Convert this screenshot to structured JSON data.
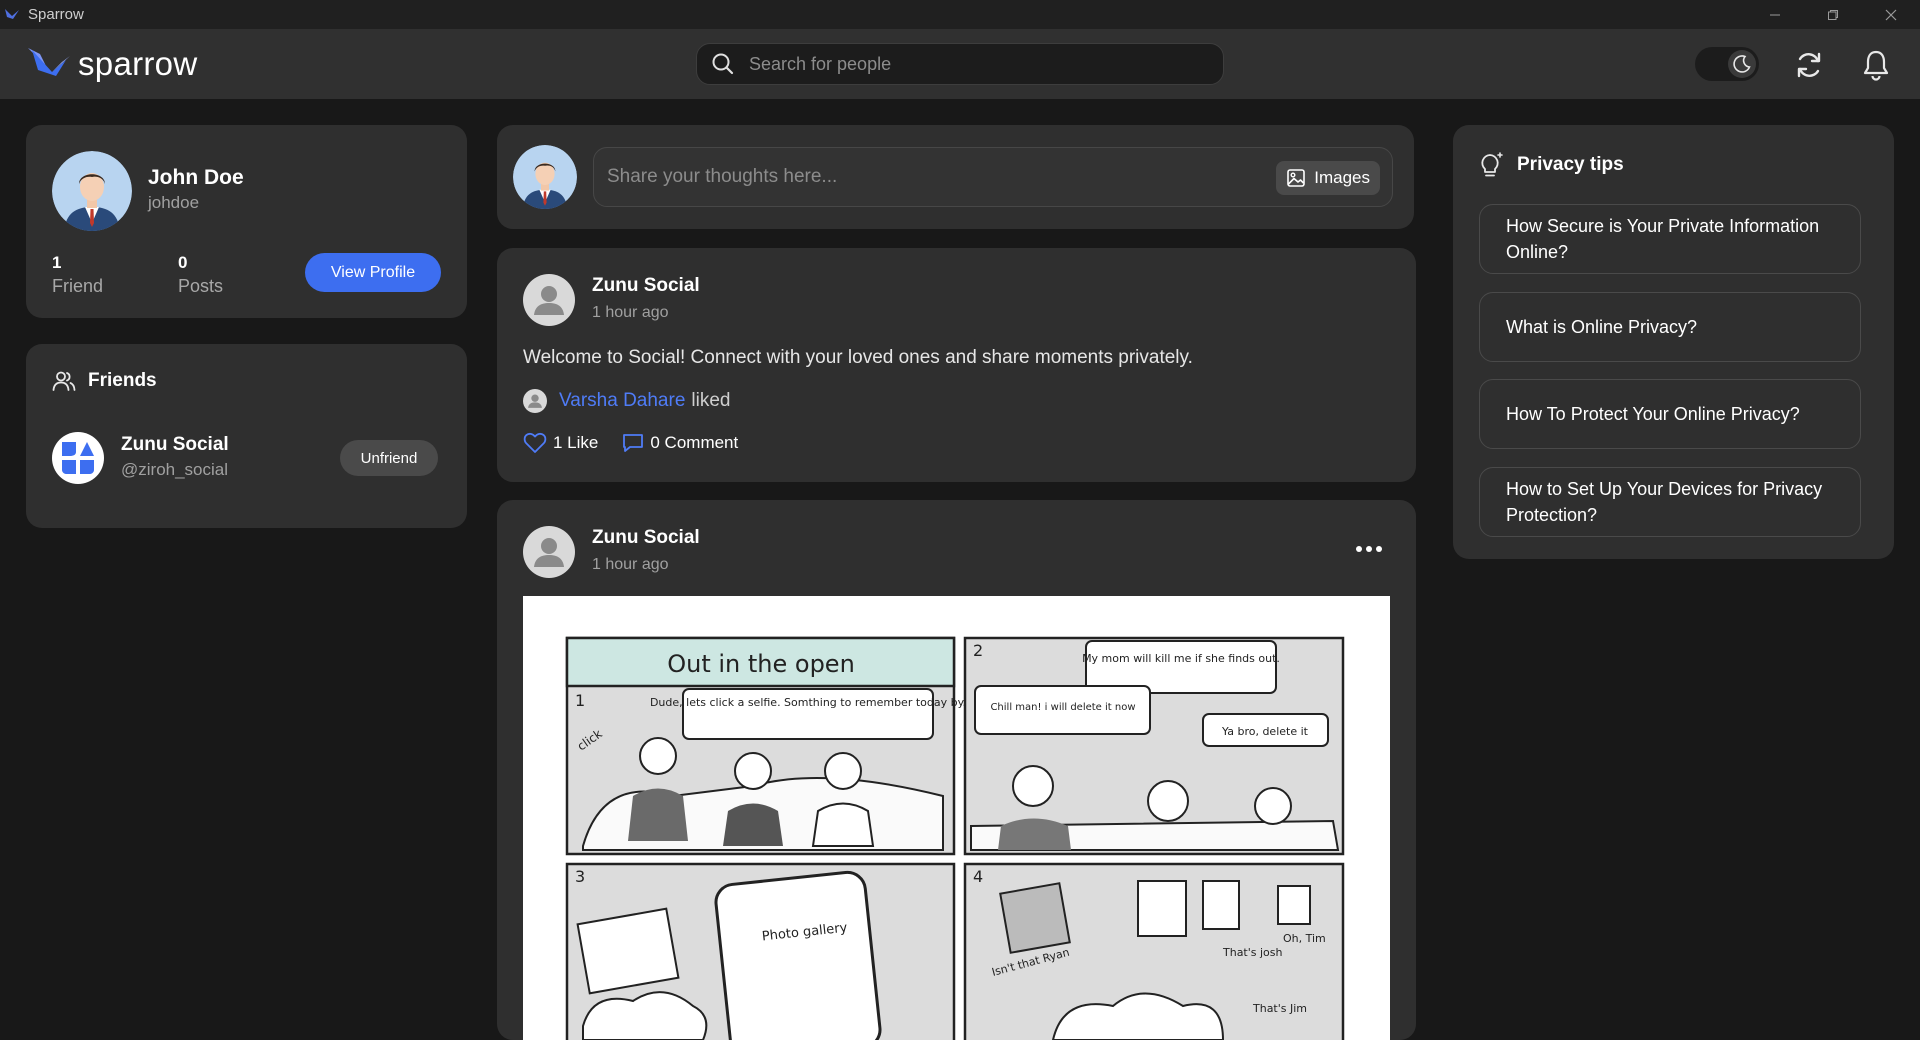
{
  "window": {
    "title": "Sparrow"
  },
  "header": {
    "logo_text": "sparrow",
    "search_placeholder": "Search for people"
  },
  "profile": {
    "name": "John Doe",
    "handle": "johdoe",
    "friends_count": "1",
    "friends_label": "Friend",
    "posts_count": "0",
    "posts_label": "Posts",
    "view_profile_label": "View Profile"
  },
  "friends": {
    "title": "Friends",
    "items": [
      {
        "name": "Zunu Social",
        "handle": "@ziroh_social",
        "action_label": "Unfriend"
      }
    ]
  },
  "composer": {
    "placeholder": "Share your thoughts here...",
    "images_label": "Images"
  },
  "feed": {
    "posts": [
      {
        "author": "Zunu Social",
        "time": "1 hour ago",
        "text": "Welcome to Social! Connect with your loved ones and share moments privately.",
        "liked_by": "Varsha Dahare",
        "liked_word": "liked",
        "likes_label": "1 Like",
        "comments_label": "0 Comment"
      },
      {
        "author": "Zunu Social",
        "time": "1 hour ago",
        "comic": {
          "title": "Out in the open",
          "panel_numbers": [
            "1",
            "2",
            "3",
            "4"
          ],
          "bubbles": [
            "Dude, lets click a selfie. Somthing to remember today by.",
            "My mom will kill me if she finds out.",
            "Chill man! i will delete it now",
            "Ya bro, delete it",
            "Photo gallery",
            "Isn't that Ryan",
            "That's josh",
            "Oh, Tim",
            "That's Jim"
          ],
          "sfx": "click"
        }
      }
    ]
  },
  "privacy_tips": {
    "title": "Privacy tips",
    "items": [
      "How Secure is Your Private Information Online?",
      "What is Online Privacy?",
      "How To Protect Your Online Privacy?",
      "How to Set Up Your Devices for Privacy Protection?"
    ]
  },
  "colors": {
    "accent": "#3d6ef0",
    "link": "#4f7cf7",
    "background": "#181818",
    "card": "#2f2f2f",
    "navbar": "#303030"
  },
  "icons": {
    "logo": "sparrow-bird-icon",
    "search": "search-icon",
    "theme": "moon-icon",
    "refresh": "refresh-icon",
    "notifications": "bell-icon",
    "friends": "users-icon",
    "images": "image-icon",
    "like": "heart-icon",
    "comment": "comment-icon",
    "more": "more-icon",
    "tips": "lightbulb-icon"
  }
}
